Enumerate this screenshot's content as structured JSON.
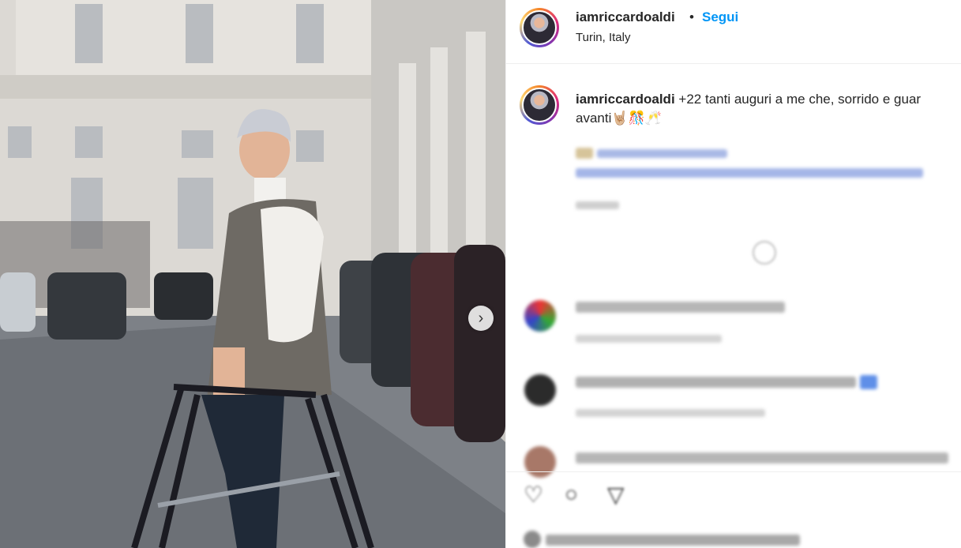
{
  "post": {
    "username": "iamriccardoaldi",
    "separator": "•",
    "follow_label": "Segui",
    "location": "Turin, Italy"
  },
  "caption": {
    "username": "iamriccardoaldi",
    "text_line1": "+22 tanti auguri a me che, sorrido e guar",
    "text_line2": "avanti🤘🏼🎊🥂"
  },
  "carousel": {
    "next_icon": "chevron-right-icon",
    "next_glyph": "›"
  },
  "actions": {
    "like_icon": "heart-icon",
    "like_glyph": "♡",
    "comment_icon": "comment-icon",
    "comment_glyph": "○",
    "share_icon": "share-icon",
    "share_glyph": "▽"
  },
  "colors": {
    "accent": "#0095f6",
    "text": "#262626"
  }
}
